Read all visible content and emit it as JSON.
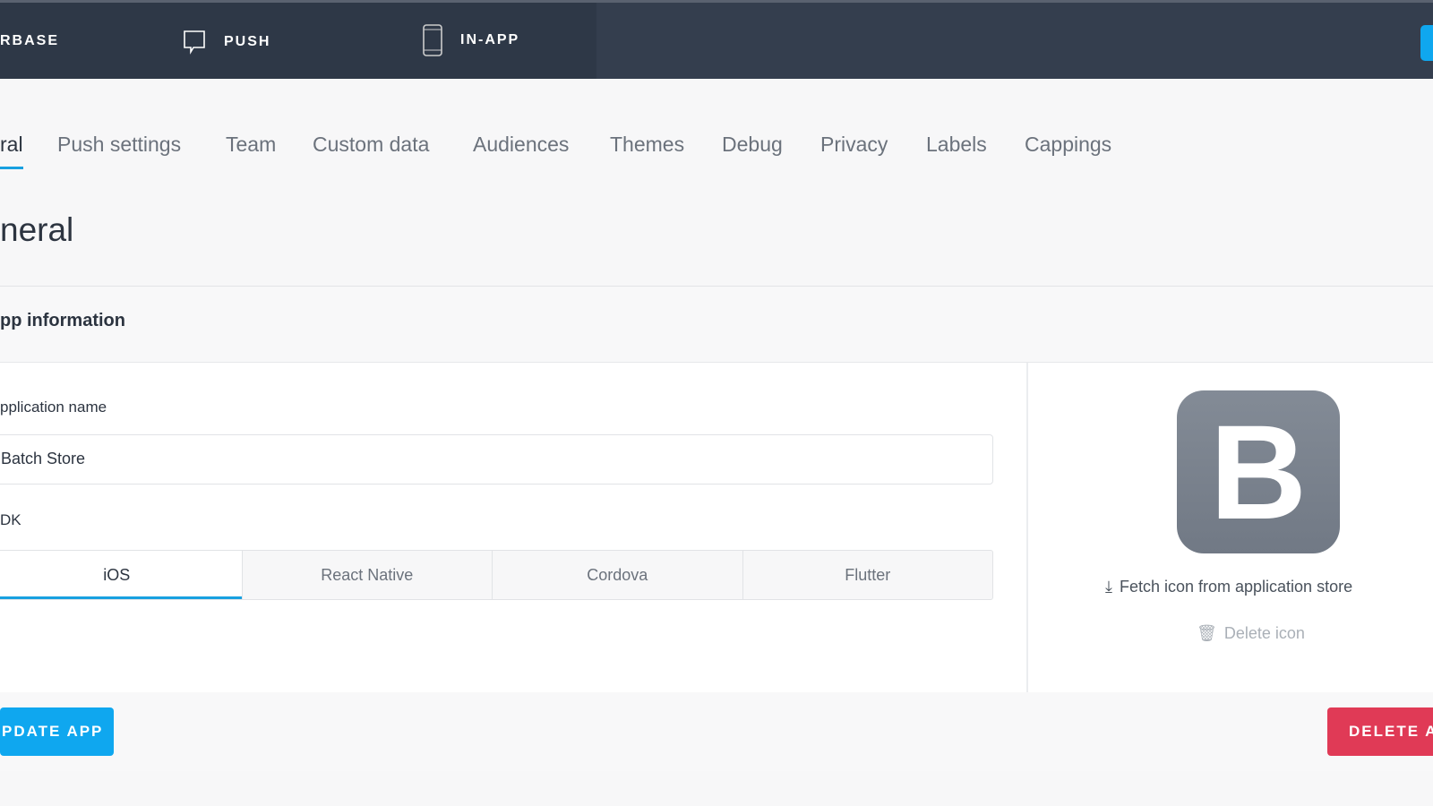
{
  "topnav": {
    "items": [
      {
        "label": "RBASE"
      },
      {
        "label": "PUSH",
        "icon": "chat-bubble-icon"
      },
      {
        "label": "IN-APP",
        "icon": "mobile-phone-icon"
      }
    ]
  },
  "tabs": [
    "ral",
    "Push settings",
    "Team",
    "Custom data",
    "Audiences",
    "Themes",
    "Debug",
    "Privacy",
    "Labels",
    "Cappings"
  ],
  "page_title": "neral",
  "section": {
    "title": "pp information",
    "app_name_label": "pplication name",
    "app_name_value": "Batch Store",
    "sdk_label": "DK",
    "sdk_options": [
      "iOS",
      "React Native",
      "Cordova",
      "Flutter"
    ],
    "sdk_selected": "iOS",
    "icon_letter": "B",
    "fetch_icon": "Fetch icon from application store",
    "delete_icon": "Delete icon",
    "update_button": "PDATE APP",
    "delete_button": "DELETE AI"
  },
  "colors": {
    "accent": "#18a0e0",
    "danger": "#e03a56",
    "nav": "#343e4e"
  }
}
